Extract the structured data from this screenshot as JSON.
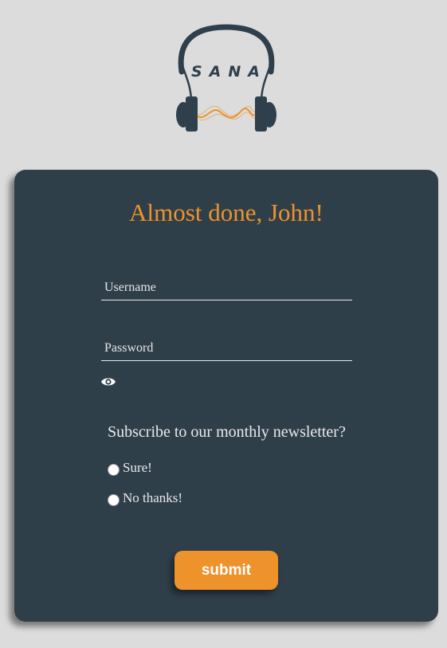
{
  "logo": {
    "text": "SANA",
    "colors": {
      "primary": "#2f3f4c",
      "accent": "#ee922b"
    }
  },
  "form": {
    "title": "Almost done, John!",
    "username": {
      "placeholder": "Username",
      "value": ""
    },
    "password": {
      "placeholder": "Password",
      "value": ""
    },
    "show_password_icon": "eye-icon",
    "newsletter": {
      "question": "Subscribe to our monthly newsletter?",
      "options": [
        {
          "label": "Sure!",
          "selected": false
        },
        {
          "label": "No thanks!",
          "selected": false
        }
      ]
    },
    "submit_label": "submit"
  },
  "colors": {
    "background": "#dcdcdc",
    "card": "#2f3f4a",
    "accent": "#ee922b",
    "text": "#eaeaea"
  }
}
